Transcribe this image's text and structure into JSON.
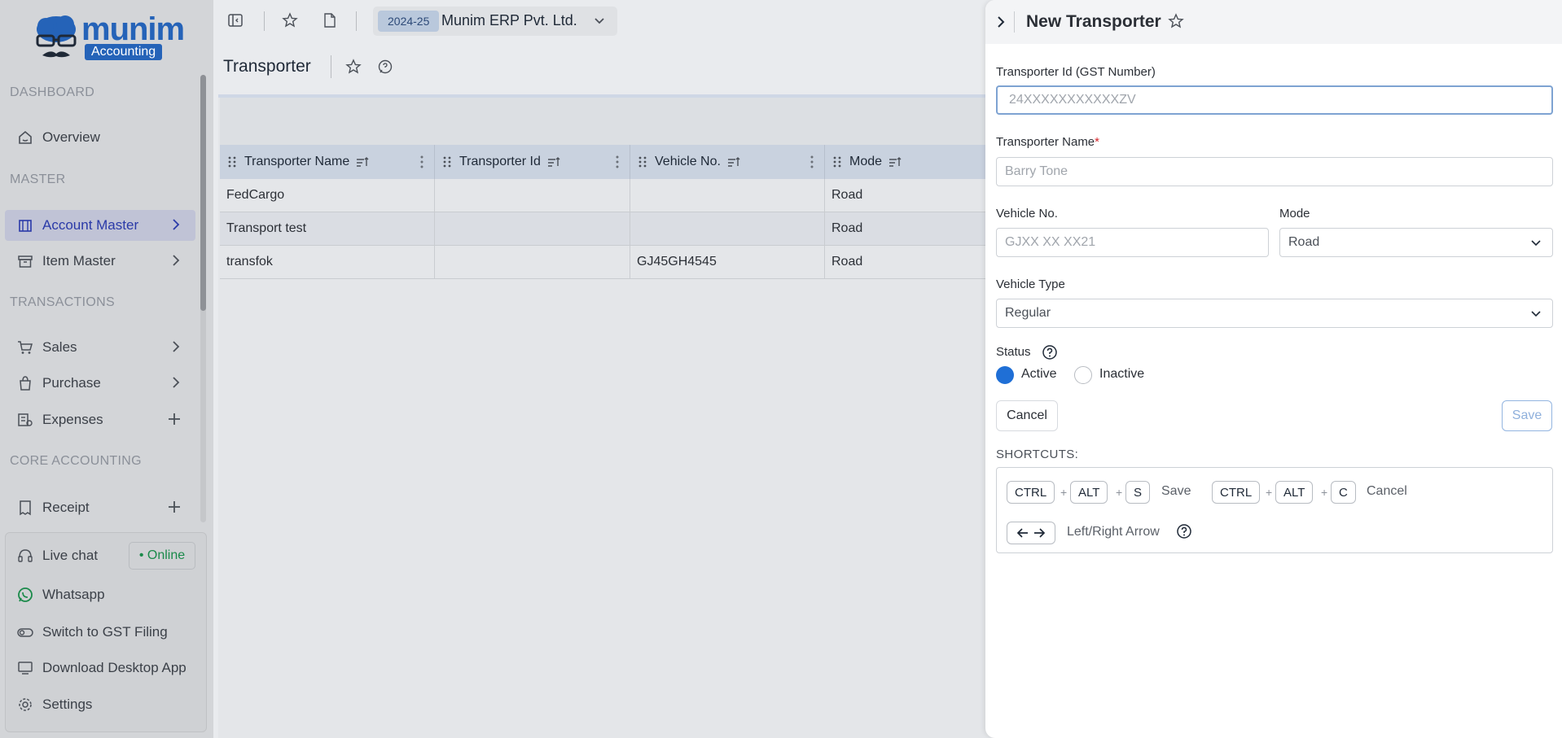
{
  "brand": {
    "word": "munim",
    "sub": "Accounting"
  },
  "sidebar": {
    "sections": {
      "dashboard": "DASHBOARD",
      "master": "MASTER",
      "transactions": "TRANSACTIONS",
      "core": "CORE ACCOUNTING"
    },
    "items": {
      "overview": "Overview",
      "account_master": "Account Master",
      "item_master": "Item Master",
      "sales": "Sales",
      "purchase": "Purchase",
      "expenses": "Expenses",
      "receipt": "Receipt"
    },
    "bottom": {
      "live_chat": "Live chat",
      "online": "• Online",
      "whatsapp": "Whatsapp",
      "gst": "Switch to GST Filing",
      "download": "Download Desktop App",
      "settings": "Settings"
    }
  },
  "topbar": {
    "fy": "2024-25",
    "company": "Munim ERP Pvt. Ltd."
  },
  "page": {
    "title": "Transporter"
  },
  "table": {
    "columns": [
      "Transporter Name",
      "Transporter Id",
      "Vehicle No.",
      "Mode"
    ],
    "rows": [
      [
        "FedCargo",
        "",
        "",
        "Road"
      ],
      [
        "Transport test",
        "",
        "",
        "Road"
      ],
      [
        "transfok",
        "",
        "GJ45GH4545",
        "Road"
      ]
    ]
  },
  "drawer": {
    "title": "New Transporter",
    "gst_label": "Transporter Id (GST Number)",
    "gst_placeholder": "24XXXXXXXXXXXZV",
    "name_label": "Transporter Name",
    "name_required": "*",
    "name_placeholder": "Barry Tone",
    "vehicle_label": "Vehicle No.",
    "vehicle_placeholder": "GJXX XX XX21",
    "mode_label": "Mode",
    "mode_value": "Road",
    "vtype_label": "Vehicle Type",
    "vtype_value": "Regular",
    "status_label": "Status",
    "status_active": "Active",
    "status_inactive": "Inactive",
    "cancel": "Cancel",
    "save": "Save",
    "shortcuts_title": "SHORTCUTS:",
    "shortcuts": {
      "ctrl": "CTRL",
      "alt": "ALT",
      "s": "S",
      "c": "C",
      "plus": "+",
      "save": "Save",
      "cancel": "Cancel",
      "arrows_label": "Left/Right Arrow"
    }
  },
  "colors": {
    "accent": "#1f6fd6",
    "active_nav": "#2a3aa8",
    "online": "#1a8a4a",
    "required": "#d4242a"
  }
}
